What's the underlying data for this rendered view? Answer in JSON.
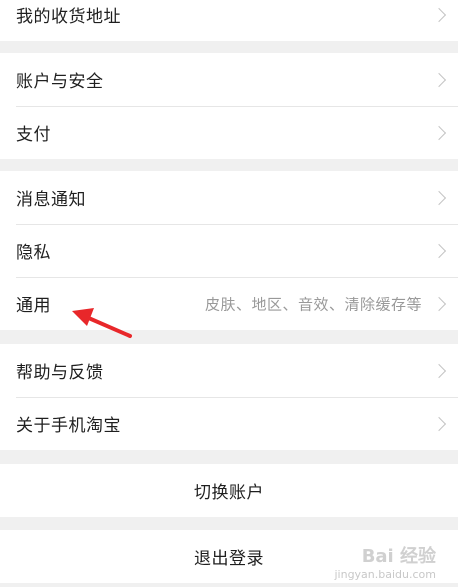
{
  "settings": {
    "address": "我的收货地址",
    "account_security": "账户与安全",
    "payment": "支付",
    "notifications": "消息通知",
    "privacy": "隐私",
    "general": "通用",
    "general_hint": "皮肤、地区、音效、清除缓存等",
    "help_feedback": "帮助与反馈",
    "about": "关于手机淘宝",
    "switch_account": "切换账户",
    "logout": "退出登录"
  },
  "watermark": {
    "logo_text": "Bai 经验",
    "url": "jingyan.baidu.com"
  },
  "colors": {
    "background": "#f0f0f0",
    "row": "#ffffff",
    "text": "#1f1f1f",
    "hint": "#999999",
    "annotation_arrow": "#e8272a"
  }
}
